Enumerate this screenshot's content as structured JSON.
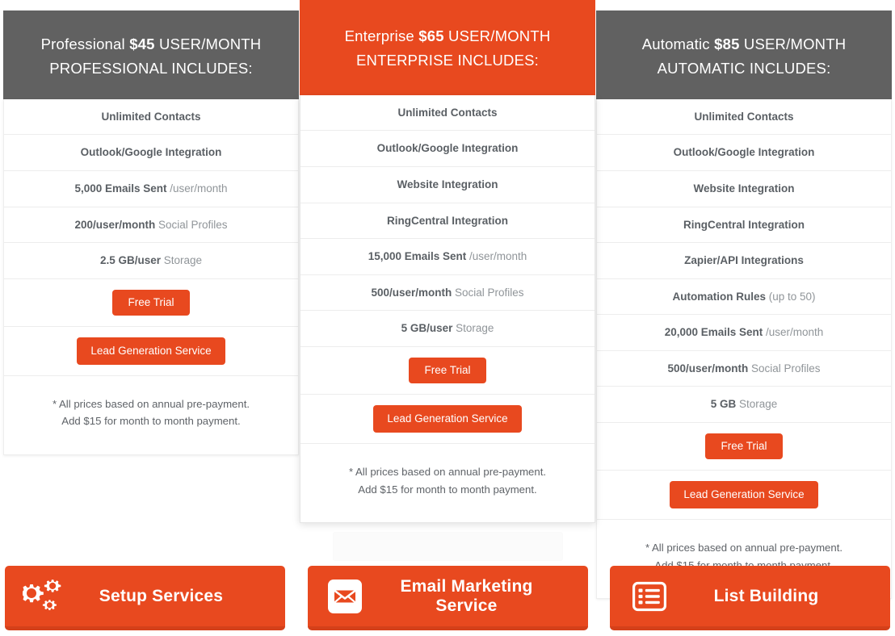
{
  "theme": {
    "accent": "#E8491F",
    "accent_dark": "#d4401a",
    "header_gray": "#616161",
    "text_bold": "#5a5f64",
    "text_light": "#909599",
    "divider": "#ededed"
  },
  "plans": [
    {
      "id": "professional",
      "name": "Professional",
      "price": "$45",
      "per": "USER/MONTH",
      "title_line1_prefix": "Professional ",
      "title_line1_suffix": " USER/MONTH",
      "title_line2": "PROFESSIONAL INCLUDES:",
      "header_style": "gray",
      "features": [
        {
          "bold": "Unlimited Contacts",
          "normal": ""
        },
        {
          "bold": "Outlook/Google Integration",
          "normal": ""
        },
        {
          "bold": "5,000 Emails Sent",
          "normal": " /user/month"
        },
        {
          "bold": "200/user/month",
          "normal": " Social Profiles"
        },
        {
          "bold": "2.5 GB/user",
          "normal": " Storage"
        }
      ],
      "trial_button": "Free Trial",
      "lead_button": "Lead Generation Service",
      "footnote_line1": "* All prices based on annual pre-payment.",
      "footnote_line2": "Add $15 for month to month payment."
    },
    {
      "id": "enterprise",
      "name": "Enterprise",
      "price": "$65",
      "per": "USER/MONTH",
      "title_line1_prefix": "Enterprise ",
      "title_line1_suffix": " USER/MONTH",
      "title_line2": "ENTERPRISE INCLUDES:",
      "header_style": "orange",
      "features": [
        {
          "bold": "Unlimited Contacts",
          "normal": ""
        },
        {
          "bold": "Outlook/Google Integration",
          "normal": ""
        },
        {
          "bold": "Website Integration",
          "normal": ""
        },
        {
          "bold": "RingCentral Integration",
          "normal": ""
        },
        {
          "bold": "15,000 Emails Sent",
          "normal": " /user/month"
        },
        {
          "bold": "500/user/month",
          "normal": " Social Profiles"
        },
        {
          "bold": "5 GB/user",
          "normal": " Storage"
        }
      ],
      "trial_button": "Free Trial",
      "lead_button": "Lead Generation Service",
      "footnote_line1": "* All prices based on annual pre-payment.",
      "footnote_line2": "Add $15 for month to month payment."
    },
    {
      "id": "automatic",
      "name": "Automatic",
      "price": "$85",
      "per": "USER/MONTH",
      "title_line1_prefix": "Automatic ",
      "title_line1_suffix": " USER/MONTH",
      "title_line2": "AUTOMATIC INCLUDES:",
      "header_style": "gray",
      "features": [
        {
          "bold": "Unlimited Contacts",
          "normal": ""
        },
        {
          "bold": "Outlook/Google Integration",
          "normal": ""
        },
        {
          "bold": "Website Integration",
          "normal": ""
        },
        {
          "bold": "RingCentral Integration",
          "normal": ""
        },
        {
          "bold": "Zapier/API Integrations",
          "normal": ""
        },
        {
          "bold": "Automation Rules",
          "normal": " (up to 50)"
        },
        {
          "bold": "20,000 Emails Sent",
          "normal": " /user/month"
        },
        {
          "bold": "500/user/month",
          "normal": " Social Profiles"
        },
        {
          "bold": "5 GB",
          "normal": " Storage"
        }
      ],
      "trial_button": "Free Trial",
      "lead_button": "Lead Generation Service",
      "footnote_line1": "* All prices based on annual pre-payment.",
      "footnote_line2": "Add $15 for month to month payment."
    }
  ],
  "bottom_buttons": [
    {
      "id": "setup-services",
      "label": "Setup Services",
      "icon": "cogs-icon"
    },
    {
      "id": "email-marketing-service",
      "label": "Email Marketing Service",
      "icon": "envelope-icon"
    },
    {
      "id": "list-building",
      "label": "List Building",
      "icon": "list-icon"
    }
  ],
  "ghost_overlay": {
    "text": ""
  }
}
